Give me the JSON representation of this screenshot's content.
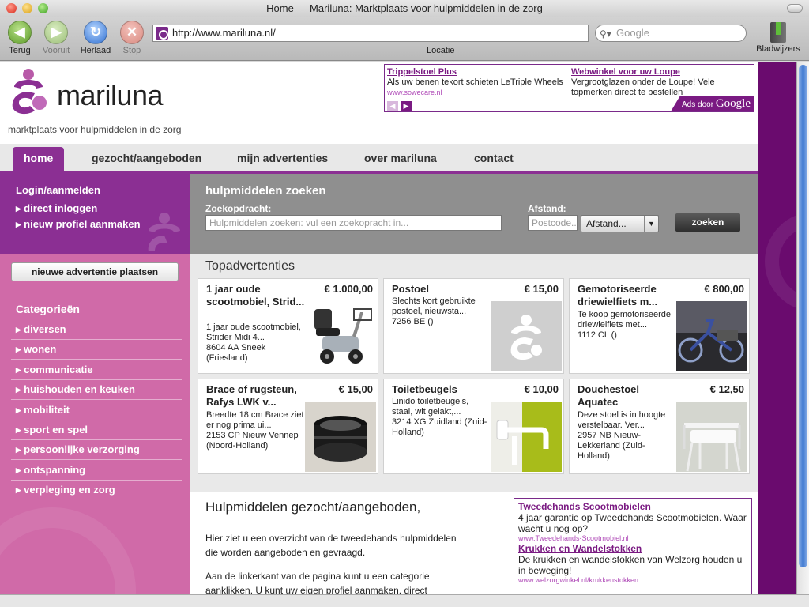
{
  "window": {
    "title": "Home — Mariluna: Marktplaats voor hulpmiddelen in de zorg"
  },
  "toolbar": {
    "back": "Terug",
    "forward": "Vooruit",
    "reload": "Herlaad",
    "stop": "Stop",
    "url": "http://www.mariluna.nl/",
    "url_label": "Locatie",
    "search_placeholder": "Google",
    "bookmarks": "Bladwijzers"
  },
  "header": {
    "brand": "mariluna",
    "tagline": "marktplaats voor hulpmiddelen in de zorg",
    "ads": [
      {
        "title": "Trippelstoel Plus",
        "text": "Als uw benen tekort schieten LeTriple Wheels",
        "url": "www.sowecare.nl"
      },
      {
        "title": "Webwinkel voor uw Loupe",
        "text": "Vergrootglazen onder de Loupe! Vele topmerken direct te bestellen",
        "url": ""
      }
    ],
    "ads_by": "Ads door",
    "ads_google": "Google"
  },
  "nav": {
    "items": [
      "home",
      "gezocht/aangeboden",
      "mijn advertenties",
      "over mariluna",
      "contact"
    ],
    "active": 0
  },
  "sidebar": {
    "login_heading": "Login/aanmelden",
    "links": [
      "direct inloggen",
      "nieuw profiel aanmaken"
    ],
    "new_ad_button": "nieuwe advertentie plaatsen",
    "categories_heading": "Categorieën",
    "categories": [
      "diversen",
      "wonen",
      "communicatie",
      "huishouden en keuken",
      "mobiliteit",
      "sport en spel",
      "persoonlijke verzorging",
      "ontspanning",
      "verpleging en zorg"
    ]
  },
  "search": {
    "title": "hulpmiddelen zoeken",
    "query_label": "Zoekopdracht:",
    "query_placeholder": "Hulpmiddelen zoeken: vul een zoekopracht in...",
    "distance_label": "Afstand:",
    "postcode_placeholder": "Postcode..",
    "distance_value": "Afstand...",
    "button": "zoeken"
  },
  "topads": {
    "title": "Topadvertenties",
    "cards": [
      {
        "title": "1 jaar oude scootmobiel, Strid...",
        "price": "€ 1.000,00",
        "desc": "1 jaar oude scootmobiel, Strider Midi 4...",
        "location": "8604 AA Sneek (Friesland)",
        "image": "scooter"
      },
      {
        "title": "Postoel",
        "price": "€ 15,00",
        "desc": "Slechts kort gebruikte postoel, nieuwsta...",
        "location": "7256 BE ()",
        "image": "placeholder"
      },
      {
        "title": "Gemotoriseerde driewielfiets m...",
        "price": "€ 800,00",
        "desc": "Te koop gemotoriseerde driewielfiets met...",
        "location": "1112 CL ()",
        "image": "tricycle"
      },
      {
        "title": "Brace of rugsteun, Rafys LWK v...",
        "price": "€ 15,00",
        "desc": "Breedte 18 cm Brace ziet er nog prima ui...",
        "location": "2153 CP Nieuw Vennep (Noord-Holland)",
        "image": "brace"
      },
      {
        "title": "Toiletbeugels",
        "price": "€ 10,00",
        "desc": "Linido toiletbeugels, staal, wit gelakt,...",
        "location": "3214 XG Zuidland (Zuid-Holland)",
        "image": "grab-bar"
      },
      {
        "title": "Douchestoel Aquatec",
        "price": "€ 12,50",
        "desc": "Deze stoel is in hoogte verstelbaar. Ver...",
        "location": "2957 NB Nieuw-Lekkerland (Zuid-Holland)",
        "image": "shower-chair"
      }
    ]
  },
  "content": {
    "heading": "Hulpmiddelen gezocht/aangeboden,",
    "p1": "Hier ziet u een overzicht van de tweedehands hulpmiddelen die worden aangeboden en gevraagd.",
    "p2": "Aan de linkerkant van de pagina kunt u een categorie aanklikken. U kunt uw eigen profiel aanmaken, direct"
  },
  "content_ads": [
    {
      "title": "Tweedehands Scootmobielen",
      "text": "4 jaar garantie op Tweedehands Scootmobielen. Waar wacht u nog op?",
      "url": "www.Tweedehands-Scootmobiel.nl"
    },
    {
      "title": "Krukken en Wandelstokken",
      "text": "De krukken en wandelstokken van Welzorg houden u in beweging!",
      "url": "www.welzorgwinkel.nl/krukkenstokken"
    }
  ],
  "colors": {
    "purple": "#8b2f93",
    "pink": "#d06aa8",
    "dark_purple": "#6a0b6e",
    "gray_panel": "#8f8f8f"
  }
}
